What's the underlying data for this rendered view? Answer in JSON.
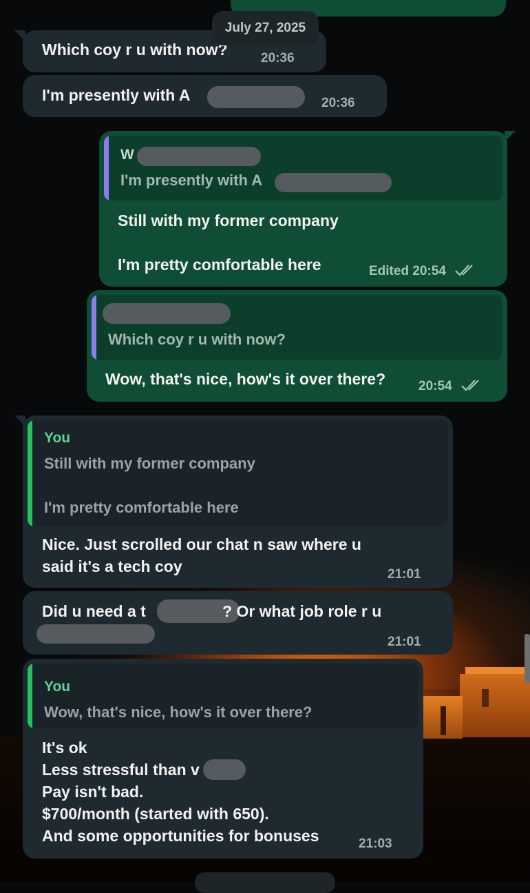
{
  "date_separator": "July 27, 2025",
  "messages": [
    {
      "id": 1,
      "direction": "in",
      "text": "Which coy r u with now?",
      "time": "20:36"
    },
    {
      "id": 2,
      "direction": "in",
      "text": "I'm presently with A",
      "time": "20:36"
    },
    {
      "id": 3,
      "direction": "out",
      "quote": {
        "sender": "W",
        "text": "I'm presently with A"
      },
      "text": "Still with my former company\n\nI'm pretty comfortable here",
      "edited_label": "Edited",
      "time": "20:54",
      "status": "read"
    },
    {
      "id": 4,
      "direction": "out",
      "quote": {
        "text": "Which coy r u with now?"
      },
      "text": "Wow, that's nice, how's it over there?",
      "time": "20:54",
      "status": "read"
    },
    {
      "id": 5,
      "direction": "in",
      "quote": {
        "sender": "You",
        "text": "Still with my former company\n\nI'm pretty comfortable here"
      },
      "text": "Nice. Just scrolled our chat n saw where u\nsaid it's a tech coy",
      "time": "21:01"
    },
    {
      "id": 6,
      "direction": "in",
      "text": "Did u need a t",
      "text_b": "? Or what job role r u",
      "text_c": "?",
      "time": "21:01"
    },
    {
      "id": 7,
      "direction": "in",
      "quote": {
        "sender": "You",
        "text": "Wow, that's nice, how's it over there?"
      },
      "text": "It's ok\nLess stressful than v\nPay isn't bad.\n$700/month (started with 650).\nAnd some opportunities for bonuses",
      "time": "21:03"
    }
  ],
  "colors": {
    "incoming_bubble": "#1f2a30",
    "outgoing_bubble": "#0f4d34",
    "quote_accent_you": "#23c25f",
    "quote_accent_other": "#8b7df0",
    "sender_you": "#60d394"
  },
  "icons": {
    "read_receipt": "double-check-icon"
  }
}
